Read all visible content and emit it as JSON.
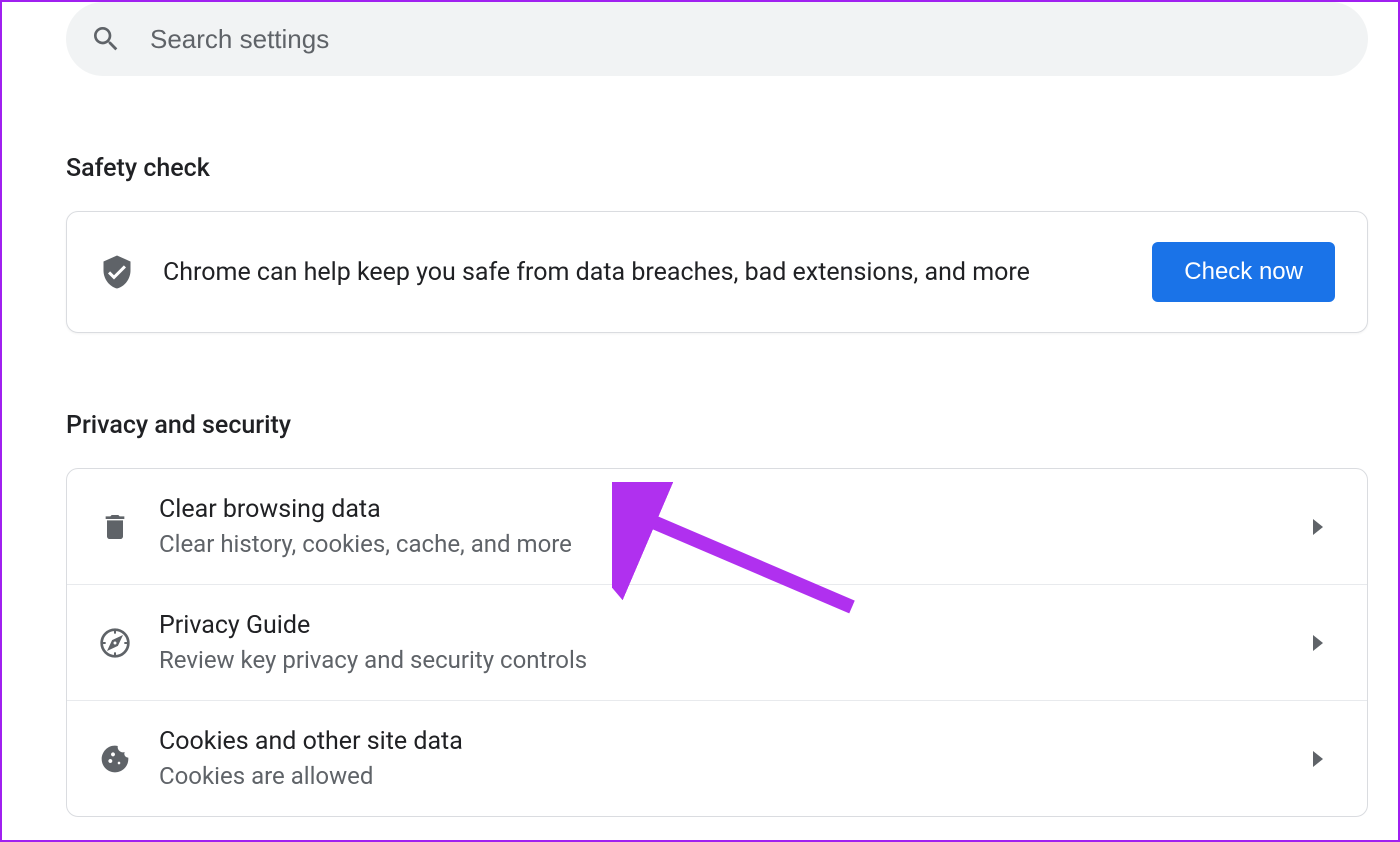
{
  "search": {
    "placeholder": "Search settings"
  },
  "sections": {
    "safety_check": {
      "title": "Safety check",
      "description": "Chrome can help keep you safe from data breaches, bad extensions, and more",
      "button_label": "Check now"
    },
    "privacy_security": {
      "title": "Privacy and security",
      "items": [
        {
          "title": "Clear browsing data",
          "subtitle": "Clear history, cookies, cache, and more"
        },
        {
          "title": "Privacy Guide",
          "subtitle": "Review key privacy and security controls"
        },
        {
          "title": "Cookies and other site data",
          "subtitle": "Cookies are allowed"
        }
      ]
    }
  }
}
